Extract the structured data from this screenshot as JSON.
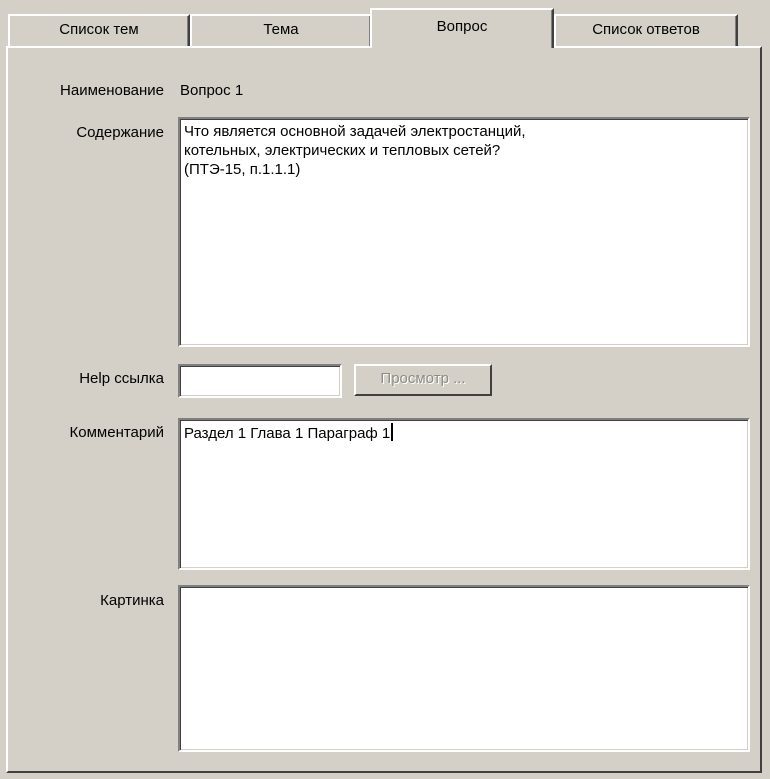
{
  "tabs": [
    {
      "label": "Список тем"
    },
    {
      "label": "Тема"
    },
    {
      "label": "Вопрос",
      "active": true
    },
    {
      "label": "Список ответов"
    }
  ],
  "form": {
    "name_label": "Наименование",
    "name_value": "Вопрос 1",
    "content_label": "Содержание",
    "content_value": "Что является основной задачей электростанций,\nкотельных, электрических и тепловых сетей?\n(ПТЭ-15, п.1.1.1)",
    "help_label": "Help ссылка",
    "help_value": "",
    "view_button_label": "Просмотр ...",
    "comment_label": "Комментарий",
    "comment_value": "Раздел 1 Глава 1 Параграф 1",
    "picture_label": "Картинка"
  },
  "colors": {
    "background": "#d4d0c8",
    "field": "#ffffff",
    "disabled_text": "#8e8b84"
  }
}
